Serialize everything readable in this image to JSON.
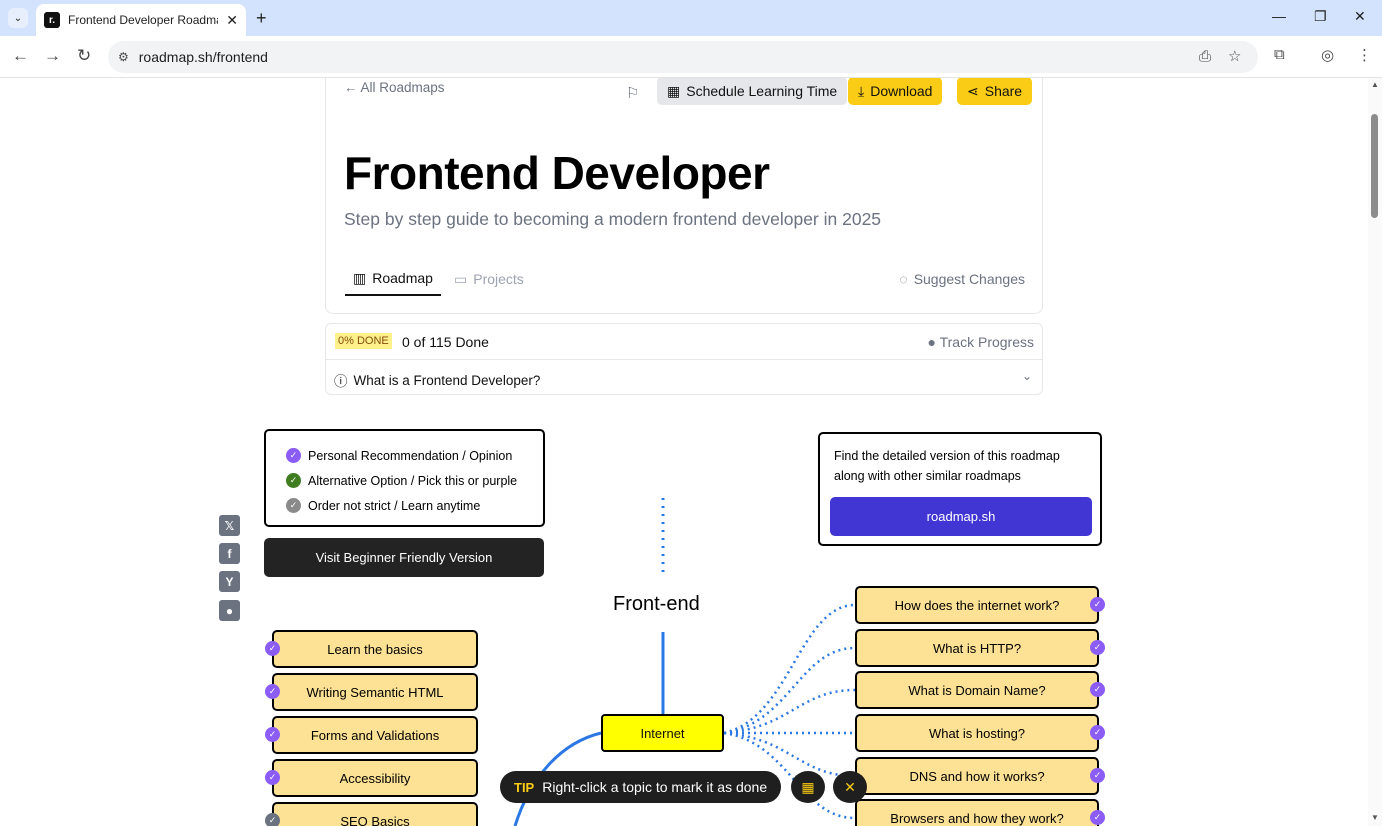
{
  "browser": {
    "tab_title": "Frontend Developer Roadma",
    "favicon_letter": "r.",
    "url": "roadmap.sh/frontend"
  },
  "header": {
    "back_link": "All Roadmaps",
    "schedule_label": "Schedule Learning Time",
    "download_label": "Download",
    "share_label": "Share",
    "title": "Frontend Developer",
    "subtitle": "Step by step guide to becoming a modern frontend developer in 2025",
    "tab_roadmap": "Roadmap",
    "tab_projects": "Projects",
    "suggest_changes": "Suggest Changes"
  },
  "progress": {
    "badge": "0% DONE",
    "count": "0 of 115 Done",
    "track": "Track Progress",
    "faq": "What is a Frontend Developer?"
  },
  "legend": {
    "items": [
      {
        "label": "Personal Recommendation / Opinion",
        "color": "#8b5cf6"
      },
      {
        "label": "Alternative Option / Pick this or purple",
        "color": "#3f7d20"
      },
      {
        "label": "Order not strict / Learn anytime",
        "color": "#8a8a8a"
      }
    ],
    "beginner_button": "Visit Beginner Friendly Version"
  },
  "info": {
    "text": "Find the detailed version of this roadmap along with other similar roadmaps",
    "button": "roadmap.sh"
  },
  "roadmap": {
    "center_label": "Front-end",
    "internet": "Internet",
    "left_nodes": [
      "Learn the basics",
      "Writing Semantic HTML",
      "Forms and Validations",
      "Accessibility",
      "SEO Basics"
    ],
    "right_nodes": [
      "How does the internet work?",
      "What is HTTP?",
      "What is Domain Name?",
      "What is hosting?",
      "DNS and how it works?",
      "Browsers and how they work?"
    ]
  },
  "tip": {
    "label": "TIP",
    "text": "Right-click a topic to mark it as done"
  }
}
